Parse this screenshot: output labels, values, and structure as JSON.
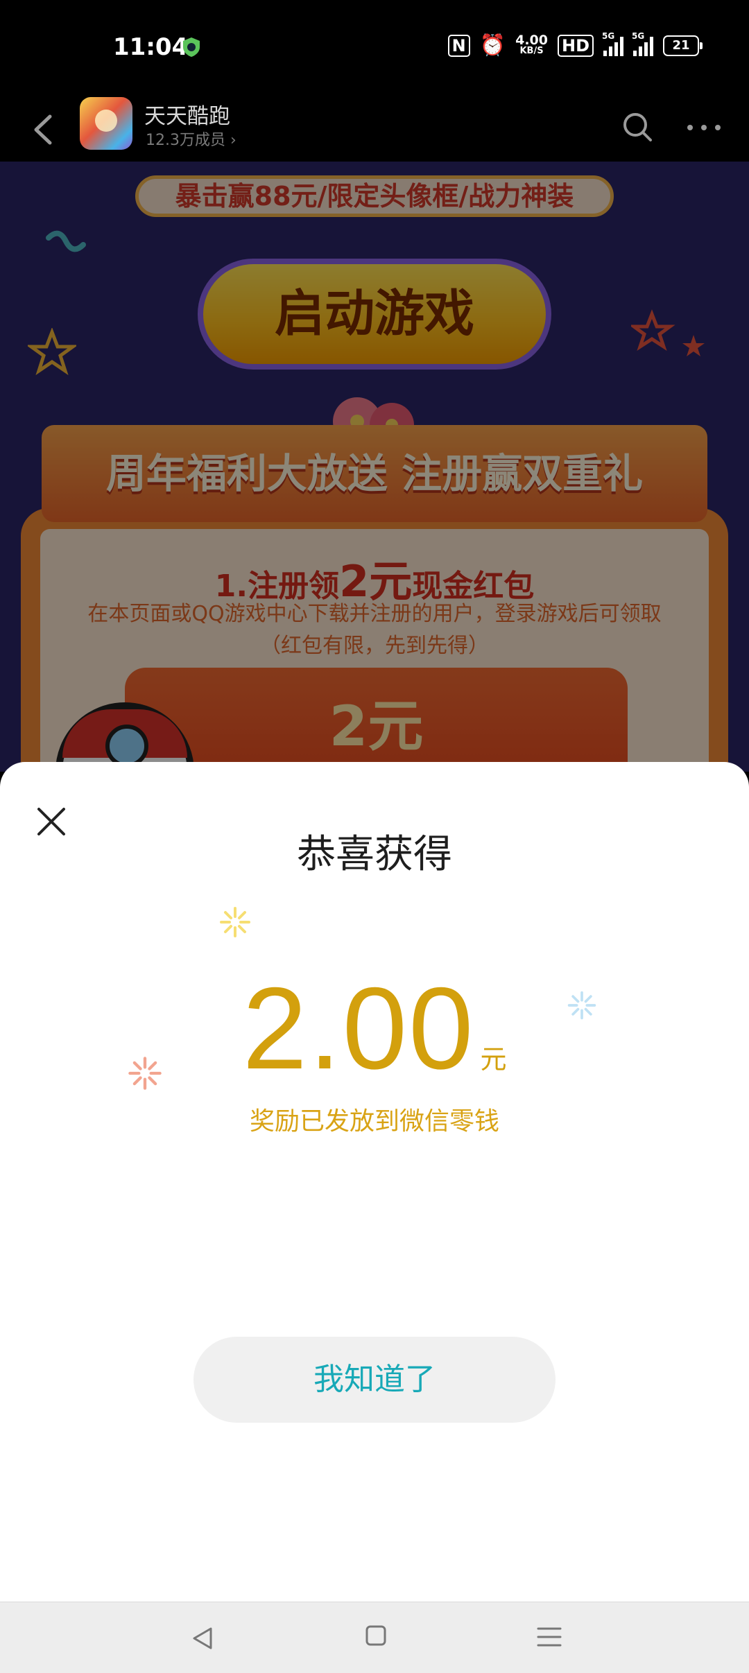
{
  "status_bar": {
    "time": "11:04",
    "nfc": "N",
    "speed_value": "4.00",
    "speed_unit": "KB/S",
    "hd": "HD",
    "signal1": "5G",
    "signal2": "5G",
    "battery": "21"
  },
  "header": {
    "app_name": "天天酷跑",
    "members": "12.3万成员 ›"
  },
  "promo": {
    "banner": "暴击赢88元/限定头像框/战力神装",
    "launch_button": "启动游戏",
    "ribbon": "周年福利大放送 注册赢双重礼",
    "reg_title_prefix": "1.注册领",
    "reg_title_amount": "2元",
    "reg_title_suffix": "现金红包",
    "reg_desc": "在本页面或QQ游戏中心下载并注册的用户，登录游戏后可领取（红包有限，先到先得）",
    "redpack_amount": "2元"
  },
  "sheet": {
    "title": "恭喜获得",
    "amount": "2.00",
    "unit": "元",
    "subtitle": "奖励已发放到微信零钱",
    "ok_button": "我知道了"
  },
  "icons": {
    "back": "chevron-left-icon",
    "search": "search-icon",
    "more": "more-horizontal-icon",
    "close": "close-icon",
    "nav_back": "triangle-back-icon",
    "nav_home": "square-home-icon",
    "nav_menu": "menu-lines-icon"
  },
  "colors": {
    "amount": "#d3a00d",
    "ok_text": "#18a9b7",
    "promo_bg": "#2a2566"
  }
}
